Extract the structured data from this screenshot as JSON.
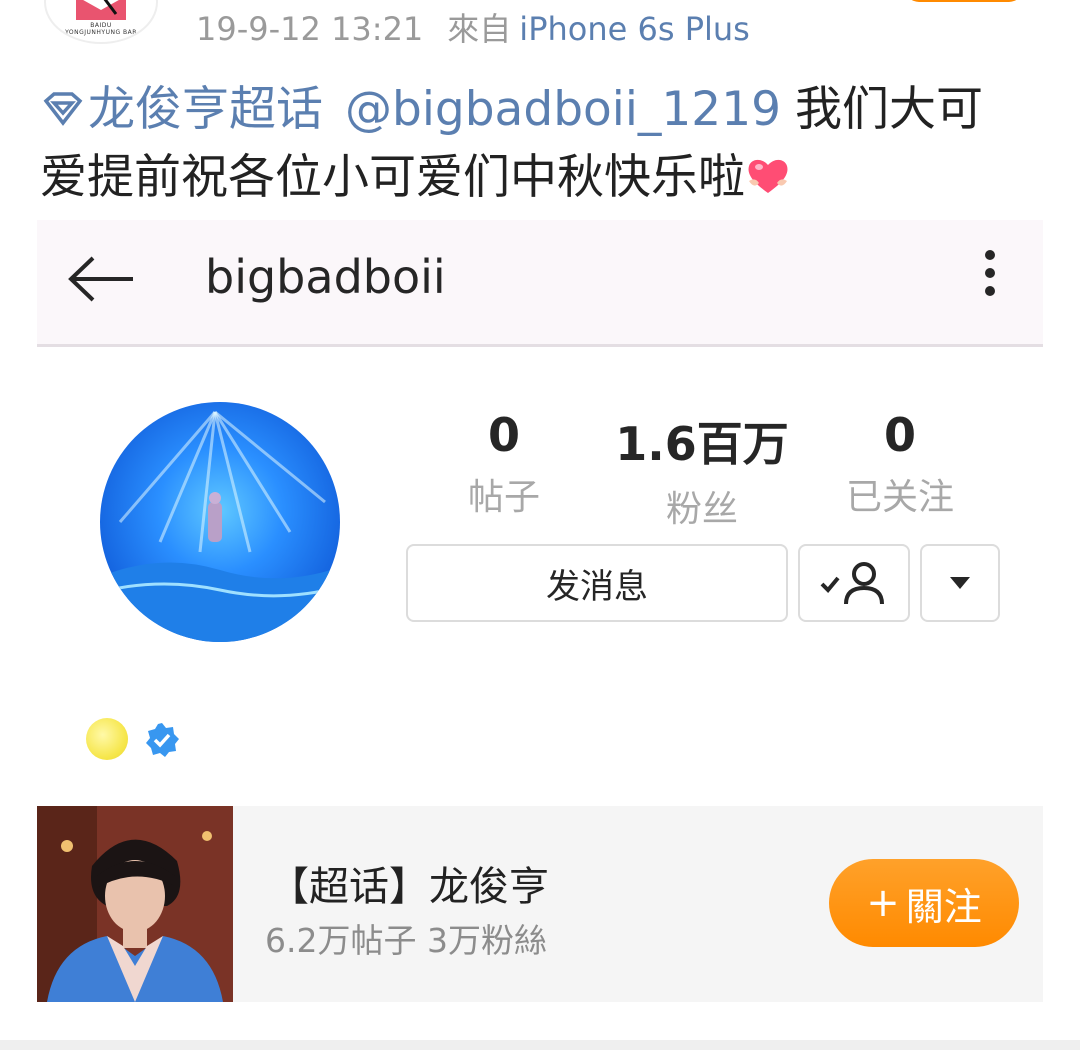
{
  "post": {
    "avatar_logo_text": "BAIDU YONGJUNHYUNG BAR",
    "timestamp": "19-9-12 13:21",
    "source_label": "來自",
    "device": "iPhone 6s Plus",
    "supertopic_tag": "龙俊亨超话",
    "mention": "@bigbadboii_1219",
    "body_line1": "我们大可",
    "body_line2": "爱提前祝各位小可爱们中秋快乐啦"
  },
  "instagram": {
    "username": "bigbadboii",
    "stats": [
      {
        "value": "0",
        "label": "帖子"
      },
      {
        "value": "1.6百万",
        "label": "粉丝"
      },
      {
        "value": "0",
        "label": "已关注"
      }
    ],
    "message_button": "发消息",
    "icons": {
      "back": "back-arrow-icon",
      "menu": "kebab-menu-icon",
      "following": "person-check-icon",
      "dropdown": "dropdown-triangle-icon",
      "verified": "verified-badge-icon"
    }
  },
  "card": {
    "title": "【超话】龙俊亨",
    "subtitle": "6.2万帖子 3万粉絲",
    "button_plus": "+",
    "button_label": "關注"
  },
  "colors": {
    "accent_orange": "#ff8a00",
    "link_blue": "#5b7fb0",
    "verified_blue": "#3897f0"
  }
}
